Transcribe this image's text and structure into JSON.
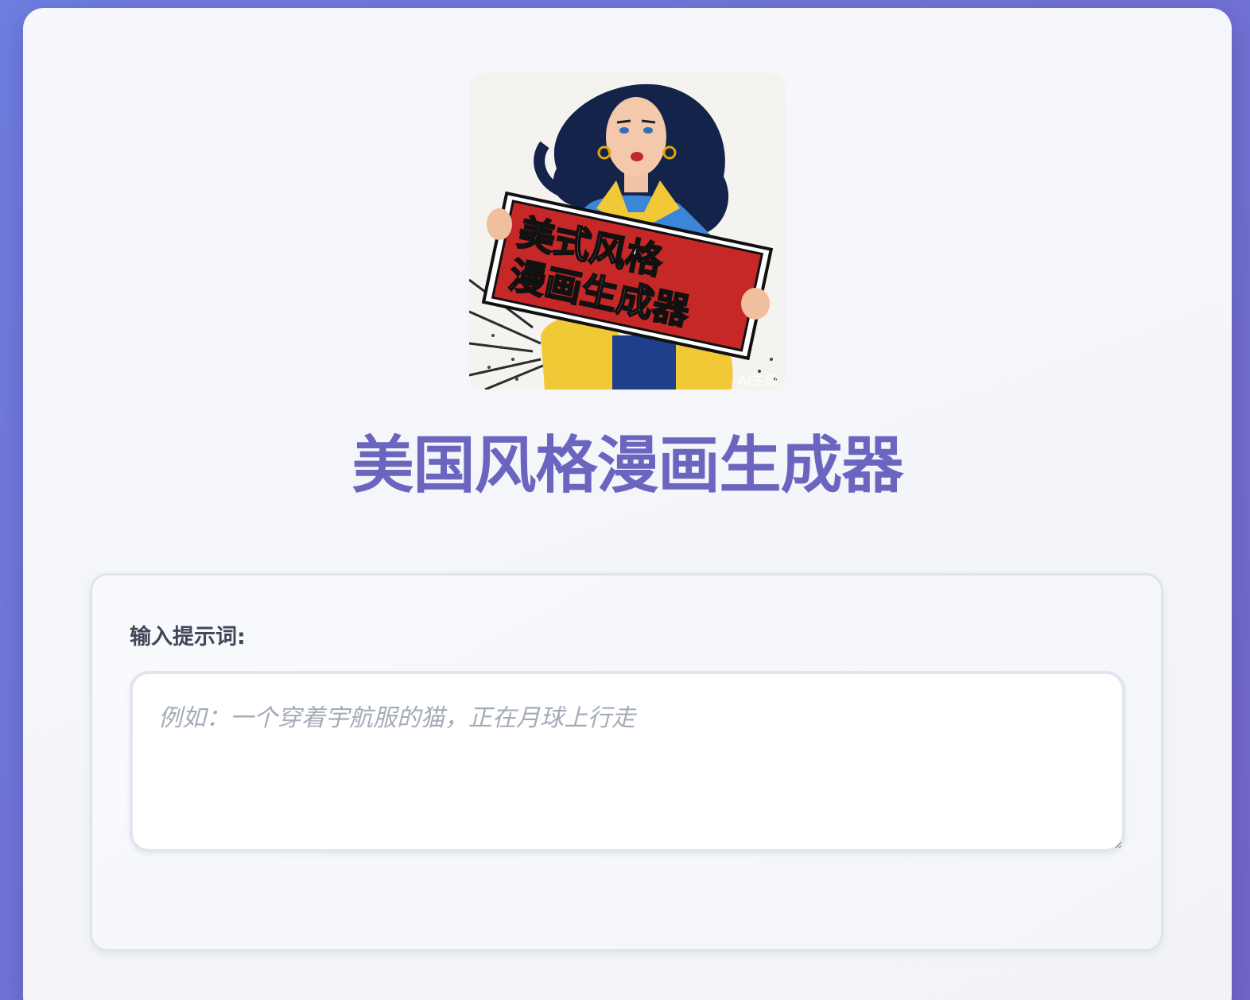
{
  "app": {
    "title": "美国风格漫画生成器"
  },
  "logo": {
    "sign_line1": "美式风格",
    "sign_line2": "漫画生成器",
    "watermark": "AI生成"
  },
  "form": {
    "prompt_label": "输入提示词:",
    "prompt_placeholder": "例如：一个穿着宇航服的猫，正在月球上行走",
    "prompt_value": ""
  },
  "colors": {
    "background_gradient_start": "#6f7fe0",
    "background_gradient_end": "#7467c9",
    "title": "#6a65bf",
    "label": "#3f4758",
    "placeholder": "#a4abb8"
  }
}
